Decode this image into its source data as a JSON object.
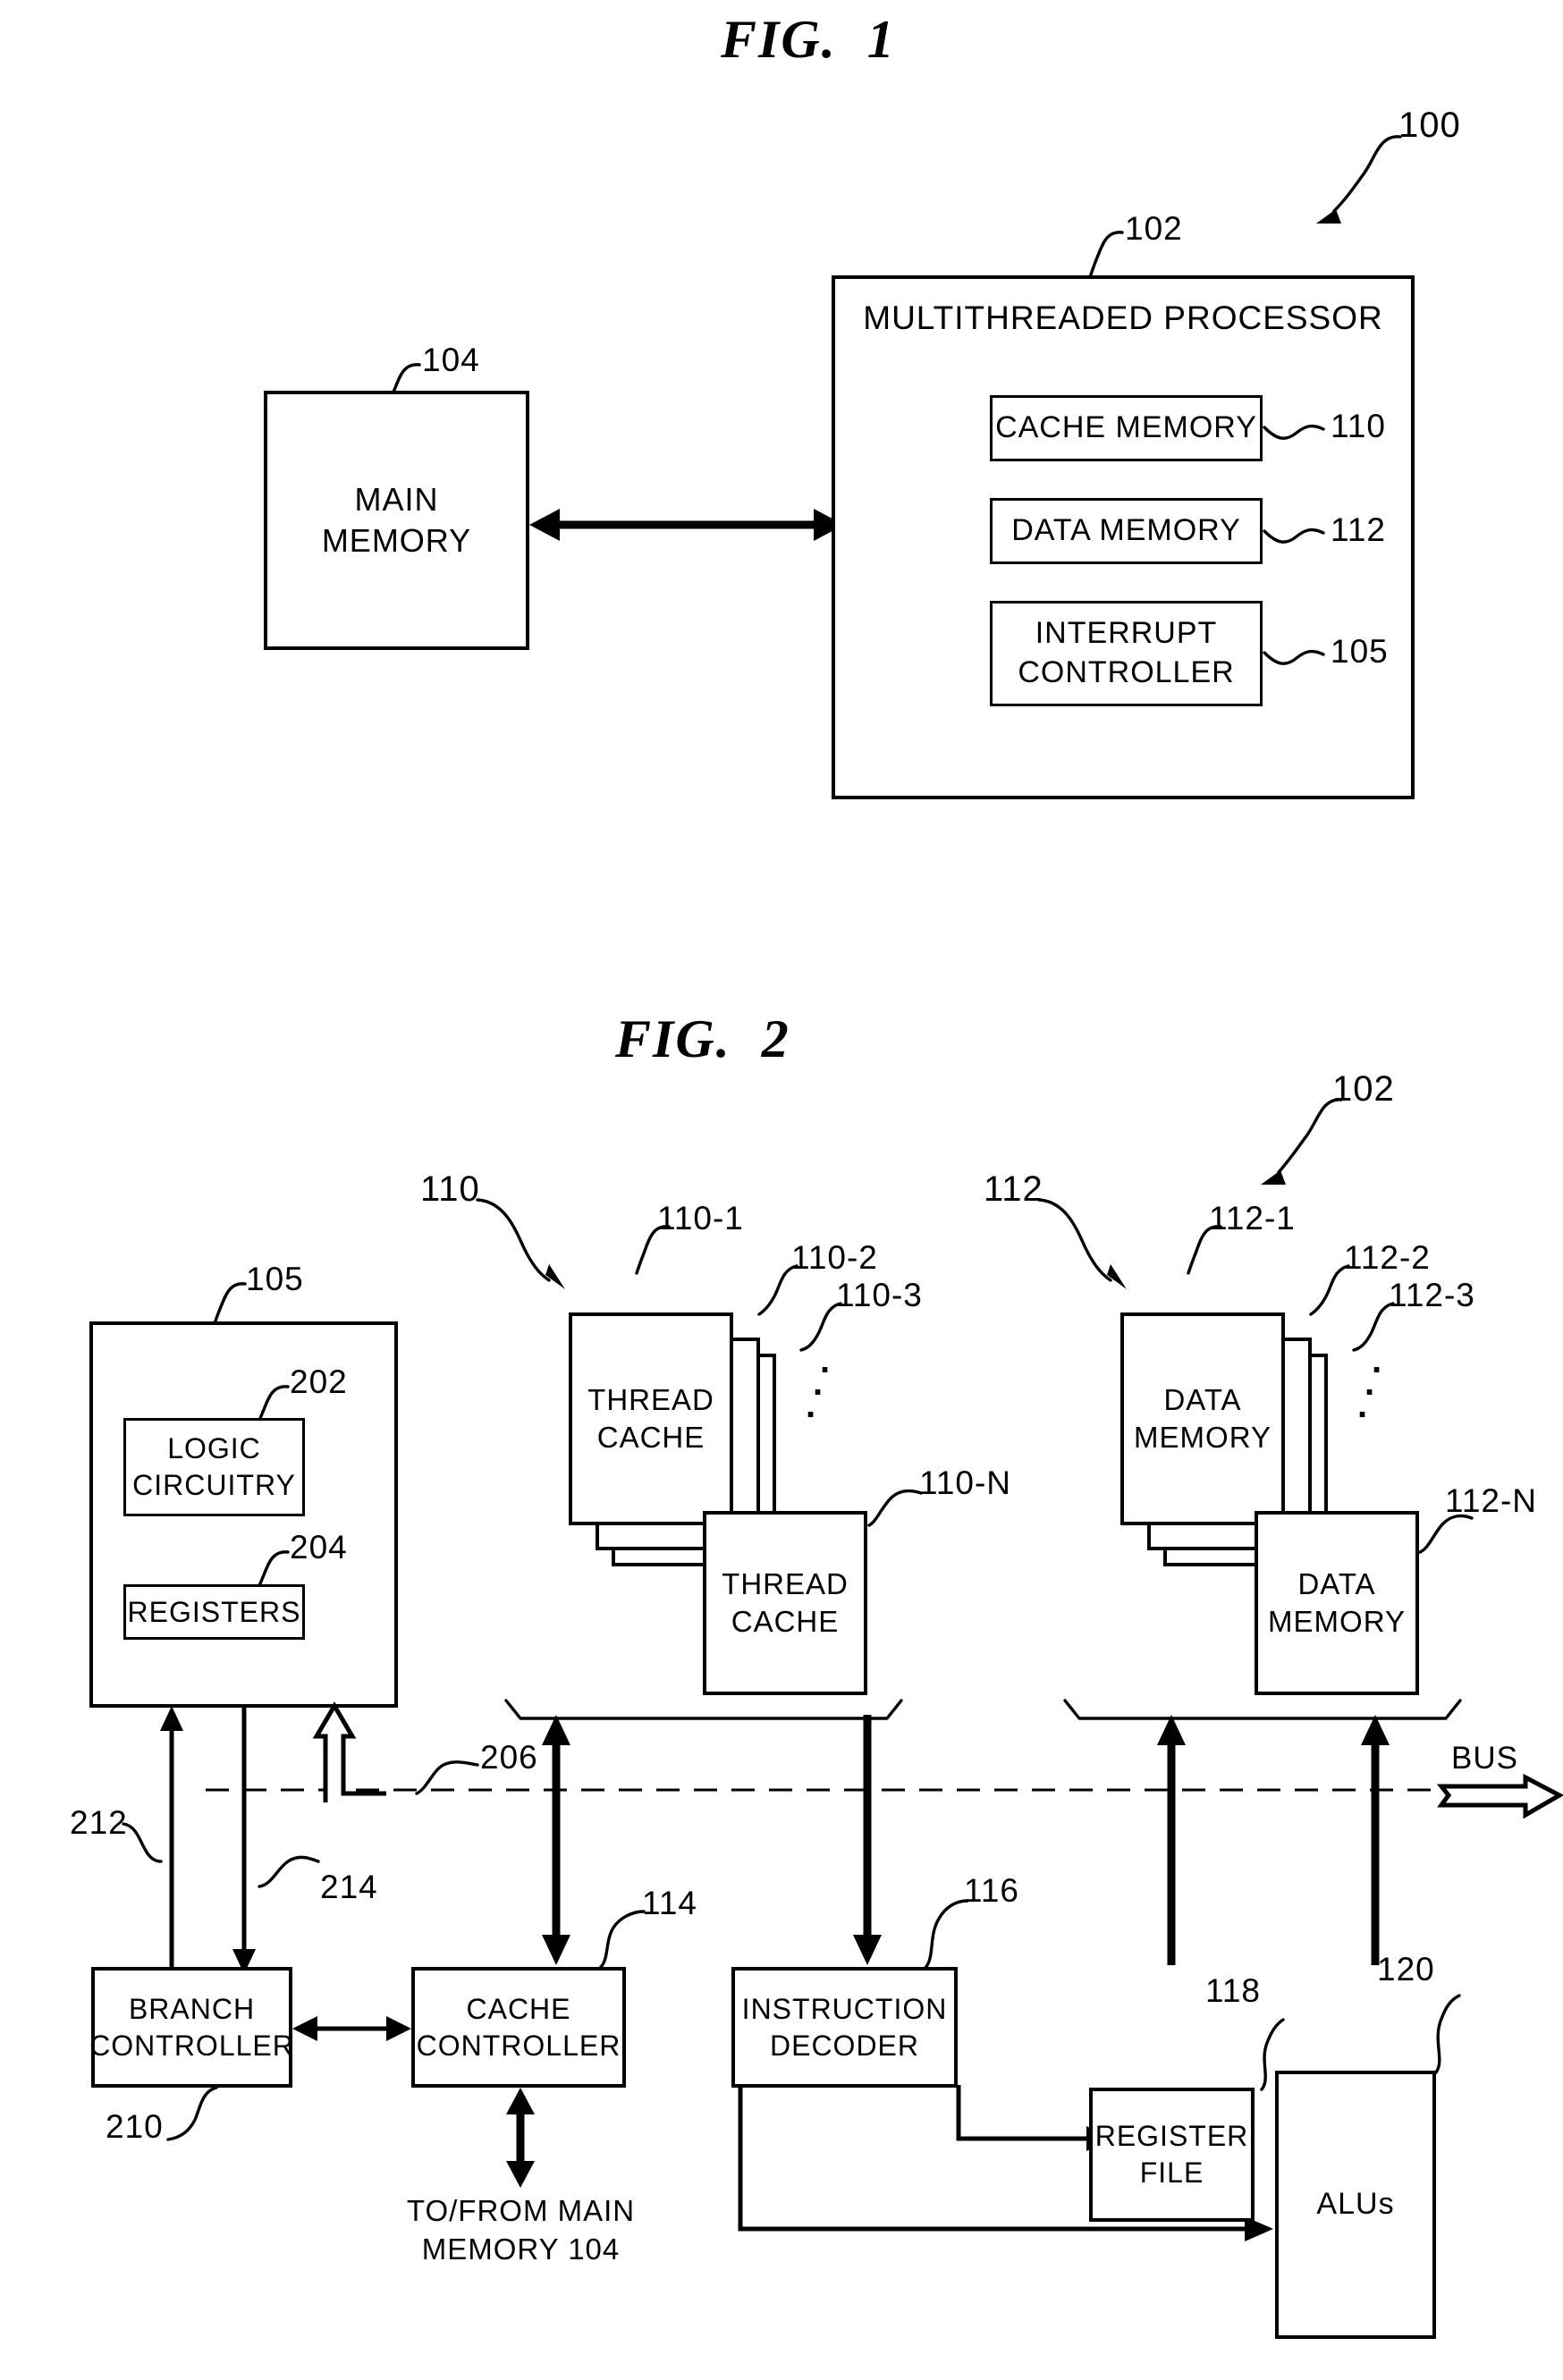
{
  "figures": [
    {
      "title": "FIG.  1",
      "system_ref": "100",
      "blocks": {
        "main_memory": {
          "label": "MAIN\nMEMORY",
          "ref": "104"
        },
        "processor": {
          "label": "MULTITHREADED PROCESSOR",
          "ref": "102"
        },
        "cache_memory": {
          "label": "CACHE MEMORY",
          "ref": "110"
        },
        "data_memory": {
          "label": "DATA MEMORY",
          "ref": "112"
        },
        "interrupt_controller": {
          "label": "INTERRUPT\nCONTROLLER",
          "ref": "105"
        }
      }
    },
    {
      "title": "FIG.  2",
      "system_ref": "102",
      "blocks": {
        "interrupt_controller": {
          "ref": "105"
        },
        "logic_circuitry": {
          "label": "LOGIC\nCIRCUITRY",
          "ref": "202"
        },
        "registers": {
          "label": "REGISTERS",
          "ref": "204"
        },
        "thread_cache_group": {
          "ref": "110"
        },
        "thread_cache_1": {
          "label": "THREAD\nCACHE",
          "ref": "110-1"
        },
        "thread_cache_2": {
          "ref": "110-2"
        },
        "thread_cache_3": {
          "ref": "110-3"
        },
        "thread_cache_n": {
          "label": "THREAD\nCACHE",
          "ref": "110-N"
        },
        "data_memory_group": {
          "ref": "112"
        },
        "data_memory_1": {
          "label": "DATA\nMEMORY",
          "ref": "112-1"
        },
        "data_memory_2": {
          "ref": "112-2"
        },
        "data_memory_3": {
          "ref": "112-3"
        },
        "data_memory_n": {
          "label": "DATA\nMEMORY",
          "ref": "112-N"
        },
        "branch_controller": {
          "label": "BRANCH\nCONTROLLER",
          "ref": "210"
        },
        "cache_controller": {
          "label": "CACHE\nCONTROLLER",
          "ref": "114"
        },
        "instruction_decoder": {
          "label": "INSTRUCTION\nDECODER",
          "ref": "116"
        },
        "register_file": {
          "label": "REGISTER\nFILE",
          "ref": "118"
        },
        "alus": {
          "label": "ALUs",
          "ref": "120"
        }
      },
      "signals": {
        "interrupt_in": {
          "ref": "206"
        },
        "branch_to_ic": {
          "ref": "212"
        },
        "ic_to_branch": {
          "ref": "214"
        }
      },
      "annotations": {
        "bus": "BUS",
        "main_memory_io": "TO/FROM MAIN\nMEMORY 104",
        "ellipsis": "."
      }
    }
  ]
}
